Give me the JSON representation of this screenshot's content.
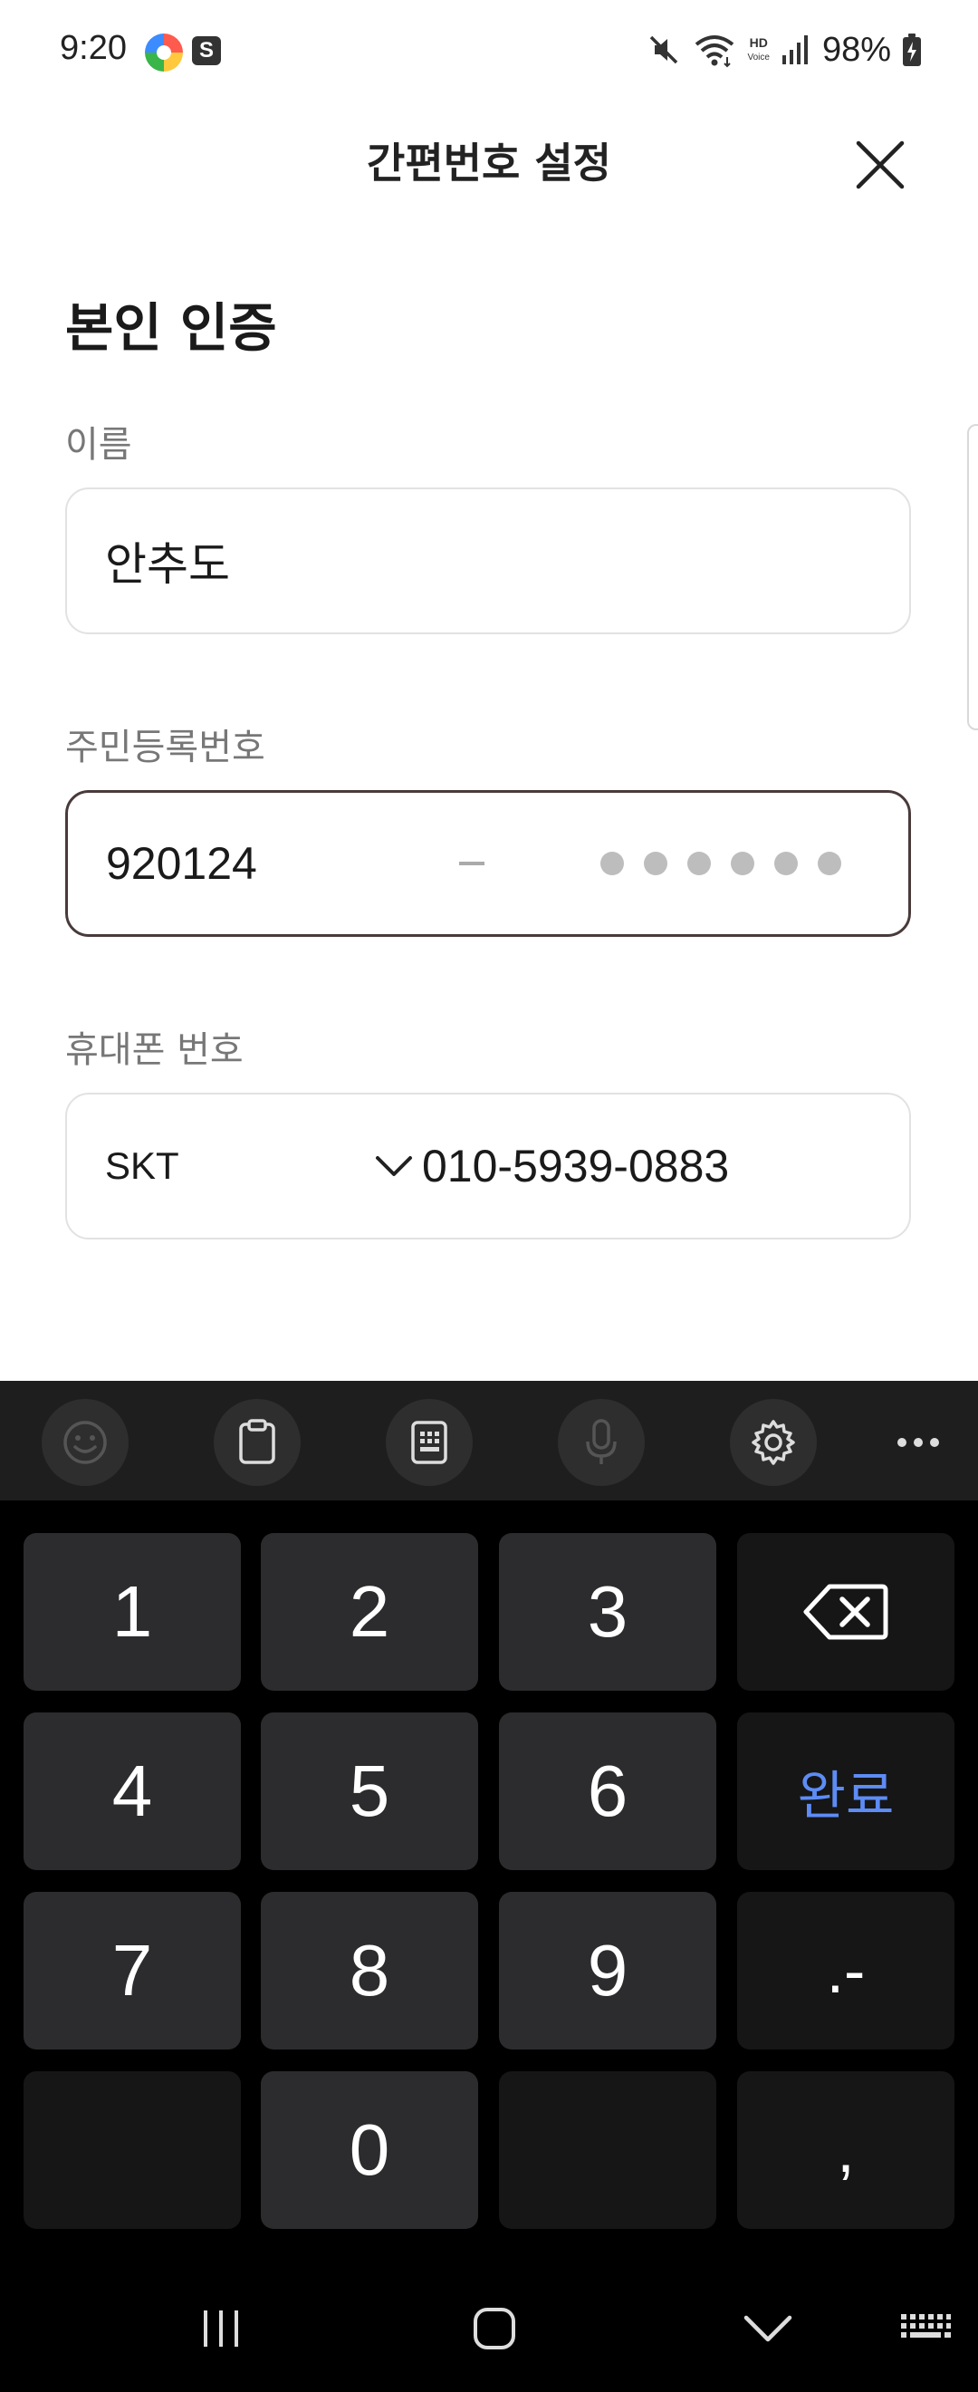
{
  "status_bar": {
    "time": "9:20",
    "battery": "98%",
    "hd_voice": "HD\nVoice",
    "app_icon_s": "S"
  },
  "header": {
    "title": "간편번호 설정"
  },
  "form": {
    "section_title": "본인 인증",
    "name": {
      "label": "이름",
      "value": "안추도"
    },
    "rrn": {
      "label": "주민등록번호",
      "front_value": "920124",
      "masked_digit_count": 6
    },
    "phone": {
      "label": "휴대폰 번호",
      "carrier": "SKT",
      "number": "010-5939-0883"
    }
  },
  "keyboard": {
    "toolbar": [
      "emoji-icon",
      "clipboard-icon",
      "keypad-icon",
      "microphone-icon",
      "settings-icon",
      "more-icon"
    ],
    "keys": {
      "k1": "1",
      "k2": "2",
      "k3": "3",
      "k4": "4",
      "k5": "5",
      "k6": "6",
      "k7": "7",
      "k8": "8",
      "k9": "9",
      "k0": "0",
      "done": "완료",
      "dot_dash": ".-",
      "comma": ","
    },
    "accent_color": "#5d8cf5"
  },
  "nav_bar": [
    "recent-apps-icon",
    "home-icon",
    "back-icon",
    "keyboard-icon"
  ]
}
